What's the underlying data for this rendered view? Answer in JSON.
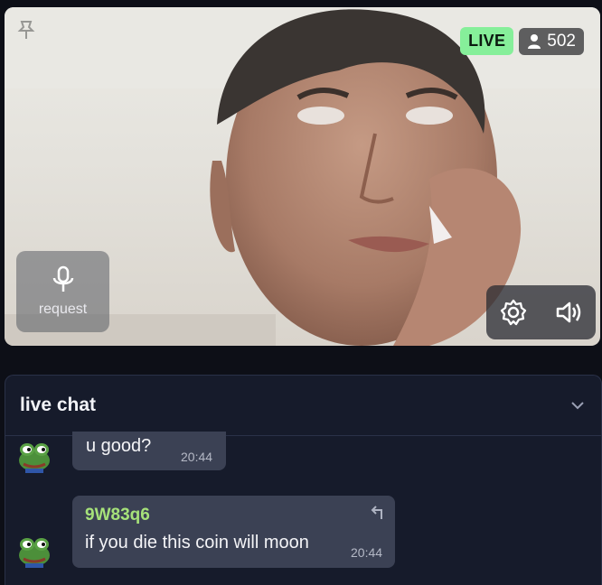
{
  "stream": {
    "live_label": "LIVE",
    "viewer_count": "502",
    "request_label": "request"
  },
  "chat": {
    "title": "live chat",
    "messages": [
      {
        "text": "u good?",
        "time": "20:44"
      },
      {
        "username": "9W83q6",
        "text": "if you die this coin will moon",
        "time": "20:44"
      }
    ]
  },
  "colors": {
    "live_badge": "#86ef9a",
    "username": "#a6e27a",
    "chat_bg": "#161b2b",
    "bubble_bg": "#3b4154"
  },
  "icons": [
    "pin-icon",
    "user-icon",
    "microphone-icon",
    "gear-icon",
    "speaker-icon",
    "chevron-down-icon",
    "reply-icon",
    "frog-avatar-icon"
  ]
}
